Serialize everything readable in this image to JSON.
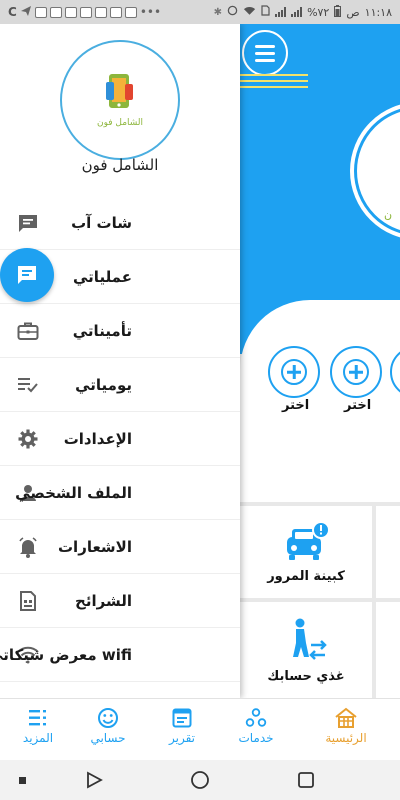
{
  "status_bar": {
    "time": "١١:١٨",
    "ampm": "ص",
    "battery": "%٧٢",
    "carrier": "C"
  },
  "drawer": {
    "app_name": "الشامل فون",
    "logo_caption": "الشامل فون",
    "menu_items": [
      {
        "label": "شات آب",
        "icon": "chat-icon"
      },
      {
        "label": "عملياتي",
        "icon": "message-icon"
      },
      {
        "label": "تأميناتي",
        "icon": "briefcase-icon"
      },
      {
        "label": "يومياتي",
        "icon": "checklist-icon"
      },
      {
        "label": "الإعدادات",
        "icon": "gear-icon"
      },
      {
        "label": "الملف الشخصي",
        "icon": "person-icon"
      },
      {
        "label": "الاشعارات",
        "icon": "bell-icon"
      },
      {
        "label": "الشرائح",
        "icon": "sim-card-icon"
      },
      {
        "label": "معرض شبكاتي wifi",
        "icon": "wifi-icon"
      }
    ]
  },
  "main": {
    "logo_text": "ن",
    "add_labels": [
      "اختر",
      "اختر"
    ],
    "tiles": [
      {
        "label": "كبينة المرور",
        "icon": "car-icon"
      },
      {
        "label": "غذي حسابك",
        "icon": "transfer-icon"
      }
    ]
  },
  "bottom_nav": [
    {
      "label": "الرئيسية",
      "icon": "home-icon",
      "active": true
    },
    {
      "label": "خدمات",
      "icon": "services-icon",
      "active": false
    },
    {
      "label": "تقرير",
      "icon": "report-icon",
      "active": false
    },
    {
      "label": "حسابي",
      "icon": "smile-icon",
      "active": false
    },
    {
      "label": "المزيد",
      "icon": "more-icon",
      "active": false
    }
  ],
  "colors": {
    "primary": "#1ea1f1",
    "active_nav": "#e8a030",
    "logo_green": "#8db63c",
    "accent_line": "#f4e26a"
  }
}
